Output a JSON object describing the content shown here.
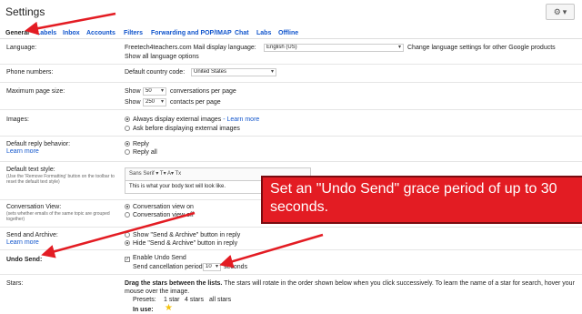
{
  "header": {
    "title": "Settings",
    "gear_icon": "gear-icon",
    "gear_caret": "▾"
  },
  "tabs": [
    {
      "label": "General"
    },
    {
      "label": "Labels"
    },
    {
      "label": "Inbox"
    },
    {
      "label": "Accounts"
    },
    {
      "label": "Filters"
    },
    {
      "label": "Forwarding and POP/IMAP"
    },
    {
      "label": "Chat"
    },
    {
      "label": "Labs"
    },
    {
      "label": "Offline"
    }
  ],
  "language": {
    "label": "Language:",
    "prefix": "Freetech4teachers.com Mail display language:",
    "selected": "English (US)",
    "change_link": "Change language settings for other Google products",
    "show_all": "Show all language options"
  },
  "phone": {
    "label": "Phone numbers:",
    "prefix": "Default country code:",
    "selected": "United States"
  },
  "page_size": {
    "label": "Maximum page size:",
    "show1": "Show",
    "conv_value": "50",
    "conv_suffix": "conversations per page",
    "show2": "Show",
    "contacts_value": "250",
    "contacts_suffix": "contacts per page"
  },
  "images": {
    "label": "Images:",
    "option1": "Always display external images",
    "learn_more": "- Learn more",
    "option2": "Ask before displaying external images"
  },
  "reply": {
    "label": "Default reply behavior:",
    "learn_more": "Learn more",
    "option1": "Reply",
    "option2": "Reply all"
  },
  "text_style": {
    "label": "Default text style:",
    "sub": "(Use the 'Remove Formatting' button on the toolbar to reset the default text style)",
    "font": "Sans Serif",
    "toolbar_icons": "▾   T▾   A▾   Tx",
    "body_text": "This is what your body text will look like."
  },
  "conversation": {
    "label": "Conversation View:",
    "sub": "(sets whether emails of the same topic are grouped together)",
    "option1": "Conversation view on",
    "option2": "Conversation view off"
  },
  "send_archive": {
    "label": "Send and Archive:",
    "learn_more": "Learn more",
    "option1": "Show \"Send & Archive\" button in reply",
    "option2": "Hide \"Send & Archive\" button in reply"
  },
  "undo_send": {
    "label": "Undo Send:",
    "option": "Enable Undo Send",
    "period_label": "Send cancellation period:",
    "period_value": "10",
    "period_suffix": "seconds"
  },
  "stars": {
    "label": "Stars:",
    "instructions_bold": "Drag the stars between the lists.",
    "instructions": "The stars will rotate in the order shown below when you click successively. To learn the name of a star for search, hover your mouse over the image.",
    "presets_label": "Presets:",
    "preset1": "1 star",
    "preset2": "4 stars",
    "preset3": "all stars",
    "in_use_label": "In use:"
  },
  "callout": {
    "text": "Set an \"Undo Send\" grace period of up to 30 seconds."
  },
  "colors": {
    "link": "#1155cc",
    "callout_red": "#e31c23",
    "arrow_red": "#e31c23",
    "star_yellow": "#f4c20d"
  }
}
